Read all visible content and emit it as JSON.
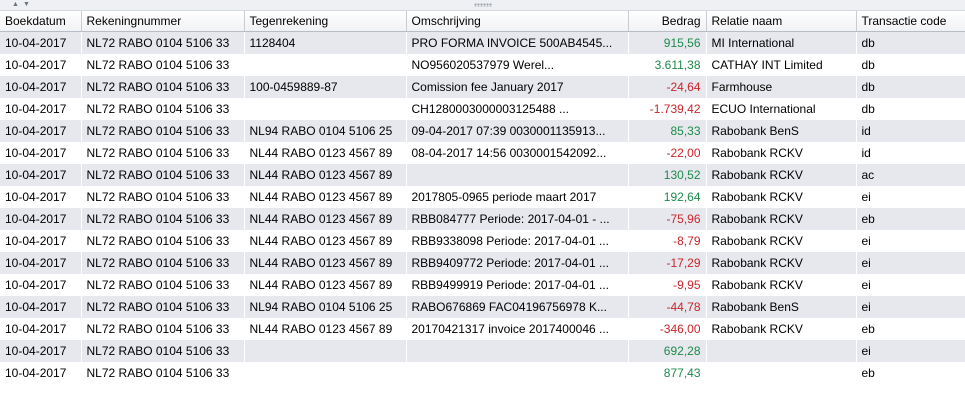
{
  "columns": [
    "Boekdatum",
    "Rekeningnummer",
    "Tegenrekening",
    "Omschrijving",
    "Bedrag",
    "Relatie naam",
    "Transactie code"
  ],
  "colors": {
    "positive": "#1e8a4b",
    "negative": "#c8262b",
    "row_alt": "#e6e8ee"
  },
  "rows": [
    {
      "date": "10-04-2017",
      "account": "NL72 RABO 0104 5106 33",
      "counter": "1128404",
      "desc": "PRO FORMA INVOICE 500AB4545...",
      "amount": "915,56",
      "sign": "pos",
      "relation": "MI International",
      "code": "db"
    },
    {
      "date": "10-04-2017",
      "account": "NL72 RABO 0104 5106 33",
      "counter": "",
      "desc": "NO956020537979           Werel...",
      "amount": "3.611,38",
      "sign": "pos",
      "relation": "CATHAY INT Limited",
      "code": "db"
    },
    {
      "date": "10-04-2017",
      "account": "NL72 RABO 0104 5106 33",
      "counter": "100-0459889-87",
      "desc": "Comission fee January 2017",
      "amount": "-24,64",
      "sign": "neg",
      "relation": "Farmhouse",
      "code": "db"
    },
    {
      "date": "10-04-2017",
      "account": "NL72 RABO 0104 5106 33",
      "counter": "",
      "desc": "CH1280003000003125488                  ...",
      "amount": "-1.739,42",
      "sign": "neg",
      "relation": "ECUO International",
      "code": "db"
    },
    {
      "date": "10-04-2017",
      "account": "NL72 RABO 0104 5106 33",
      "counter": "NL94 RABO 0104 5106 25",
      "desc": "09-04-2017 07:39 0030001135913...",
      "amount": "85,33",
      "sign": "pos",
      "relation": "Rabobank BenS",
      "code": "id"
    },
    {
      "date": "10-04-2017",
      "account": "NL72 RABO 0104 5106 33",
      "counter": "NL44 RABO 0123 4567 89",
      "desc": "08-04-2017 14:56 0030001542092...",
      "amount": "-22,00",
      "sign": "neg",
      "relation": "Rabobank RCKV",
      "code": "id"
    },
    {
      "date": "10-04-2017",
      "account": "NL72 RABO 0104 5106 33",
      "counter": "NL44 RABO 0123 4567 89",
      "desc": "",
      "amount": "130,52",
      "sign": "pos",
      "relation": "Rabobank RCKV",
      "code": "ac"
    },
    {
      "date": "10-04-2017",
      "account": "NL72 RABO 0104 5106 33",
      "counter": "NL44 RABO 0123 4567 89",
      "desc": "2017805-0965 periode maart 2017",
      "amount": "192,64",
      "sign": "pos",
      "relation": "Rabobank RCKV",
      "code": "ei"
    },
    {
      "date": "10-04-2017",
      "account": "NL72 RABO 0104 5106 33",
      "counter": "NL44 RABO 0123 4567 89",
      "desc": "RBB084777 Periode: 2017-04-01 - ...",
      "amount": "-75,96",
      "sign": "neg",
      "relation": "Rabobank RCKV",
      "code": "eb"
    },
    {
      "date": "10-04-2017",
      "account": "NL72 RABO 0104 5106 33",
      "counter": "NL44 RABO 0123 4567 89",
      "desc": "RBB9338098 Periode: 2017-04-01 ...",
      "amount": "-8,79",
      "sign": "neg",
      "relation": "Rabobank RCKV",
      "code": "ei"
    },
    {
      "date": "10-04-2017",
      "account": "NL72 RABO 0104 5106 33",
      "counter": "NL44 RABO 0123 4567 89",
      "desc": "RBB9409772 Periode: 2017-04-01 ...",
      "amount": "-17,29",
      "sign": "neg",
      "relation": "Rabobank RCKV",
      "code": "ei"
    },
    {
      "date": "10-04-2017",
      "account": "NL72 RABO 0104 5106 33",
      "counter": "NL44 RABO 0123 4567 89",
      "desc": "RBB9499919 Periode: 2017-04-01 ...",
      "amount": "-9,95",
      "sign": "neg",
      "relation": "Rabobank RCKV",
      "code": "ei"
    },
    {
      "date": "10-04-2017",
      "account": "NL72 RABO 0104 5106 33",
      "counter": "NL94 RABO 0104 5106 25",
      "desc": "RABO676869 FAC04196756978 K...",
      "amount": "-44,78",
      "sign": "neg",
      "relation": "Rabobank BenS",
      "code": "ei"
    },
    {
      "date": "10-04-2017",
      "account": "NL72 RABO 0104 5106 33",
      "counter": "NL44 RABO 0123 4567 89",
      "desc": "20170421317 invoice 2017400046 ...",
      "amount": "-346,00",
      "sign": "neg",
      "relation": "Rabobank RCKV",
      "code": "eb"
    },
    {
      "date": "10-04-2017",
      "account": "NL72 RABO 0104 5106 33",
      "counter": "",
      "desc": "",
      "amount": "692,28",
      "sign": "pos",
      "relation": "",
      "code": "ei"
    },
    {
      "date": "10-04-2017",
      "account": "NL72 RABO 0104 5106 33",
      "counter": "",
      "desc": "",
      "amount": "877,43",
      "sign": "pos",
      "relation": "",
      "code": "eb"
    }
  ]
}
